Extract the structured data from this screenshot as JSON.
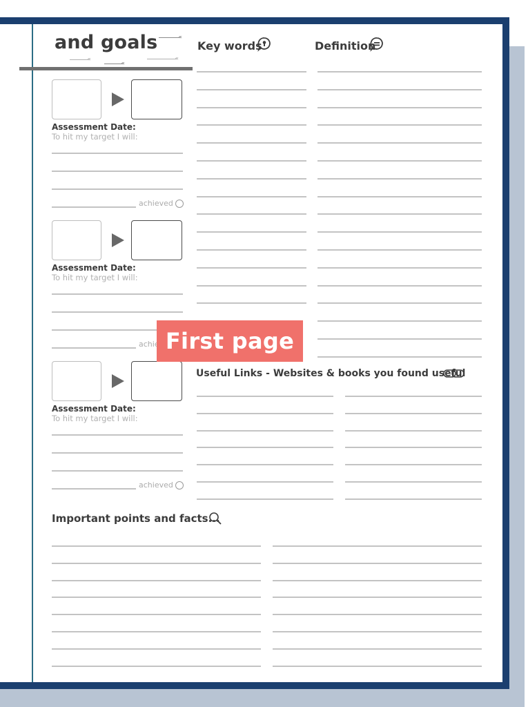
{
  "header": {
    "title": "and goals"
  },
  "columns": {
    "key_words": "Key words",
    "definition": "Definition"
  },
  "icons": {
    "key_words": "keyhole-speech-icon",
    "definition": "speech-bubble-icon",
    "useful_links": "link-icon",
    "important_points": "search-icon"
  },
  "target_blocks": [
    {
      "assessment_label": "Assessment Date:",
      "target_prompt": "To hit my target I will:",
      "achieved_label": "achieved"
    },
    {
      "assessment_label": "Assessment Date:",
      "target_prompt": "To hit my target I will:",
      "achieved_label": "achieved"
    },
    {
      "assessment_label": "Assessment Date:",
      "target_prompt": "To hit my target I will:",
      "achieved_label": "achieved"
    }
  ],
  "useful_links": {
    "heading": "Useful Links - Websites & books you found useful"
  },
  "important_points": {
    "heading": "Important points and facts..."
  },
  "overlay": {
    "label": "First page",
    "color": "#f0716b"
  },
  "colors": {
    "frame": "#1b3f6f",
    "shadow": "#b8c4d3",
    "margin_line": "#2c6d85"
  }
}
